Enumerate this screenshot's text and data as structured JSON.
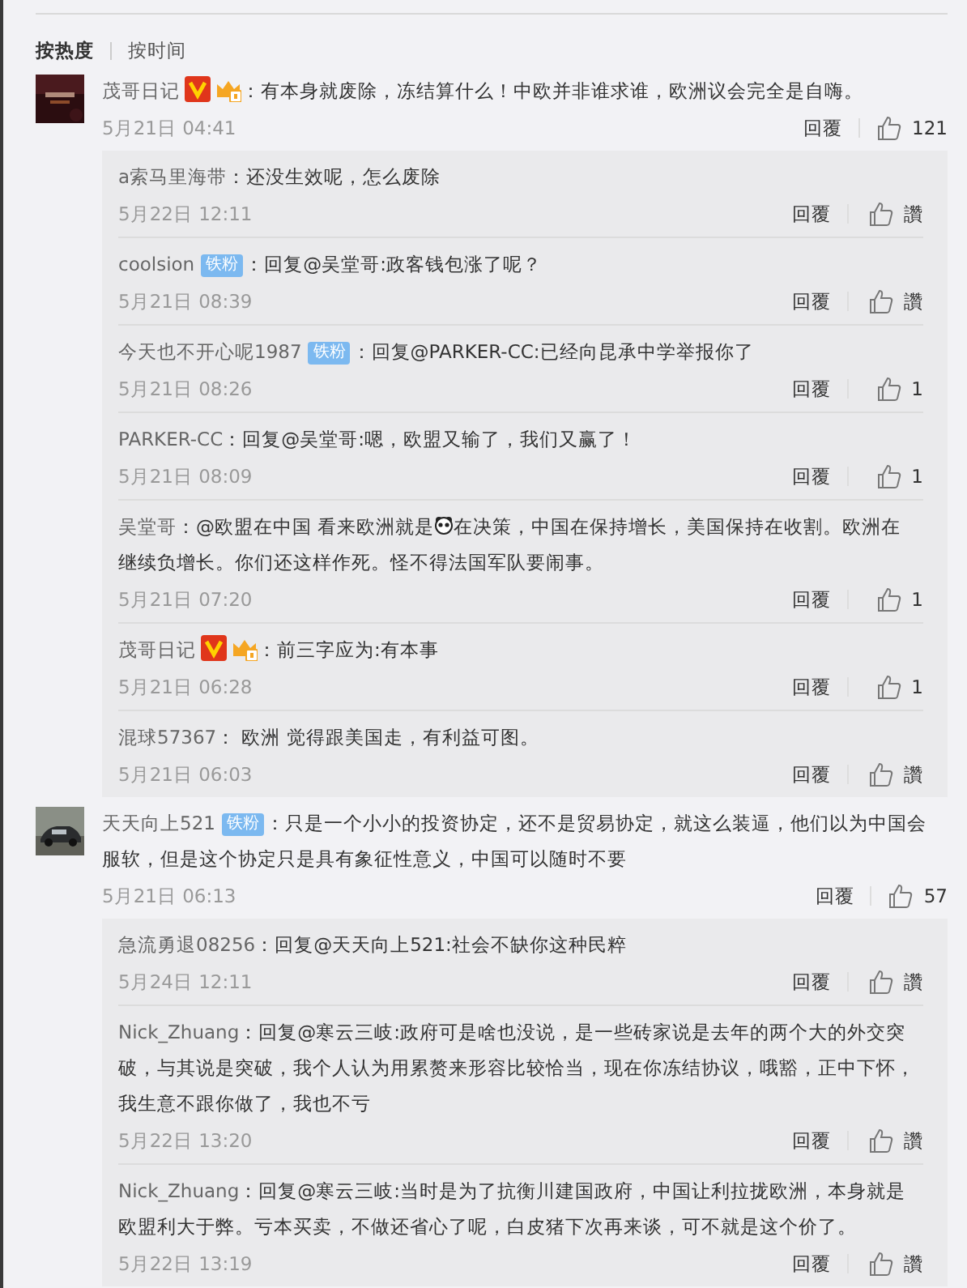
{
  "tabs": [
    {
      "label": "按热度",
      "selected": true
    },
    {
      "label": "按时间",
      "selected": false
    }
  ],
  "comments": [
    {
      "user": "茂哥日记",
      "badges": [
        {
          "kind": "verified"
        },
        {
          "kind": "crown"
        }
      ],
      "text": "：有本身就废除，冻结算什么！中欧并非谁求谁，欧洲议会完全是自嗨。",
      "time": "5月21日 04:41",
      "reply": "回覆",
      "likes": "121",
      "replies": [
        {
          "user": "a索马里海带",
          "text": "：还没生效呢，怎么废除",
          "time": "5月22日 12:11",
          "reply": "回覆",
          "likes": "讚"
        },
        {
          "user": "coolsion",
          "badges": [
            {
              "kind": "fan",
              "text": "铁粉"
            }
          ],
          "text": "：回复@吴堂哥:政客钱包涨了呢？",
          "time": "5月21日 08:39",
          "reply": "回覆",
          "likes": "讚"
        },
        {
          "user": "今天也不开心呢1987",
          "badges": [
            {
              "kind": "fan",
              "text": "铁粉"
            }
          ],
          "text": "：回复@PARKER-CC:已经向昆承中学举报你了",
          "time": "5月21日 08:26",
          "reply": "回覆",
          "likes": "1"
        },
        {
          "user": "PARKER-CC",
          "text": "：回复@吴堂哥:嗯，欧盟又输了，我们又赢了！",
          "time": "5月21日 08:09",
          "reply": "回覆",
          "likes": "1"
        },
        {
          "user": "吴堂哥",
          "text": "：@欧盟在中国 看来欧洲就是",
          "text_after": "在决策，中国在保持增长，美国保持在收割。欧洲在继续负增长。你们还这样作死。怪不得法国军队要闹事。",
          "time": "5月21日 07:20",
          "reply": "回覆",
          "likes": "1"
        },
        {
          "user": "茂哥日记",
          "badges": [
            {
              "kind": "verified"
            },
            {
              "kind": "crown"
            }
          ],
          "text": "：前三字应为:有本事",
          "time": "5月21日 06:28",
          "reply": "回覆",
          "likes": "1"
        },
        {
          "user": "混球57367",
          "text": "： 欧洲 觉得跟美国走，有利益可图。",
          "time": "5月21日 06:03",
          "reply": "回覆",
          "likes": "讚"
        }
      ]
    },
    {
      "user": "天天向上521",
      "badges": [
        {
          "kind": "fan",
          "text": "铁粉"
        }
      ],
      "text": "：只是一个小小的投资协定，还不是贸易协定，就这么装逼，他们以为中国会服软，但是这个协定只是具有象征性意义，中国可以随时不要",
      "time": "5月21日 06:13",
      "reply": "回覆",
      "likes": "57",
      "replies": [
        {
          "user": "急流勇退08256",
          "text": "：回复@天天向上521:社会不缺你这种民粹",
          "time": "5月24日 12:11",
          "reply": "回覆",
          "likes": "讚"
        },
        {
          "user": "Nick_Zhuang",
          "text": "：回复@寒云三岐:政府可是啥也没说，是一些砖家说是去年的两个大的外交突破，与其说是突破，我个人认为用累赘来形容比较恰当，现在你冻结协议，哦豁，正中下怀，我生意不跟你做了，我也不亏",
          "time": "5月22日 13:20",
          "reply": "回覆",
          "likes": "讚"
        },
        {
          "user": "Nick_Zhuang",
          "text": "：回复@寒云三岐:当时是为了抗衡川建国政府，中国让利拉拢欧洲，本身就是欧盟利大于弊。亏本买卖，不做还省心了呢，白皮猪下次再来谈，可不就是这个价了。",
          "time": "5月22日 13:19",
          "reply": "回覆",
          "likes": "讚"
        }
      ]
    }
  ]
}
